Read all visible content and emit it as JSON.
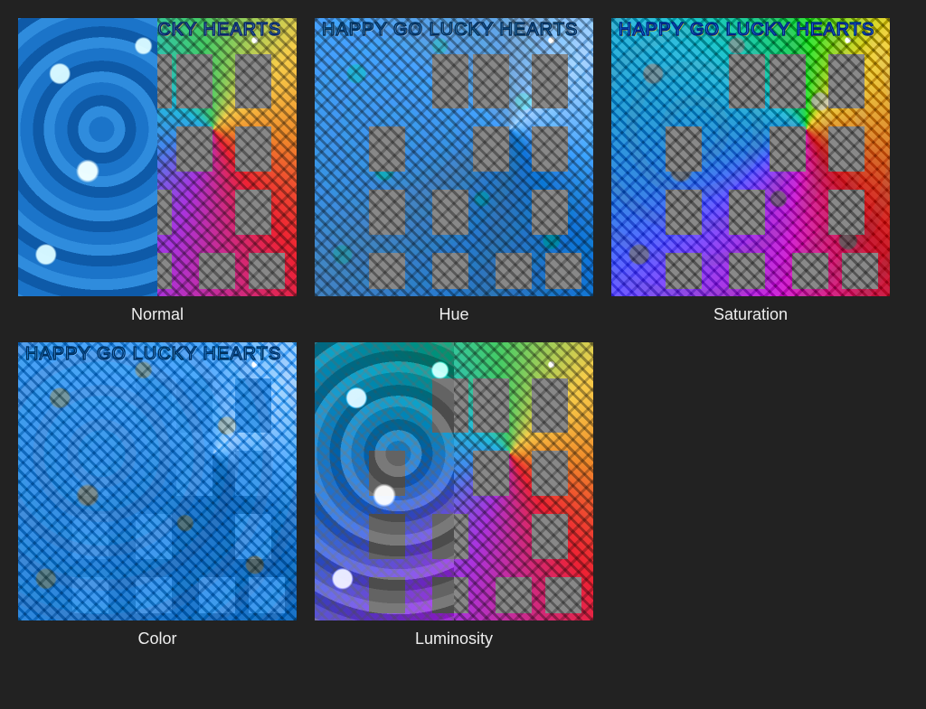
{
  "banner_text": "HAPPY GO LUCKY HEARTS",
  "modes": [
    {
      "key": "normal",
      "label": "Normal"
    },
    {
      "key": "hue",
      "label": "Hue"
    },
    {
      "key": "saturation",
      "label": "Saturation"
    },
    {
      "key": "color",
      "label": "Color"
    },
    {
      "key": "luminosity",
      "label": "Luminosity"
    }
  ]
}
